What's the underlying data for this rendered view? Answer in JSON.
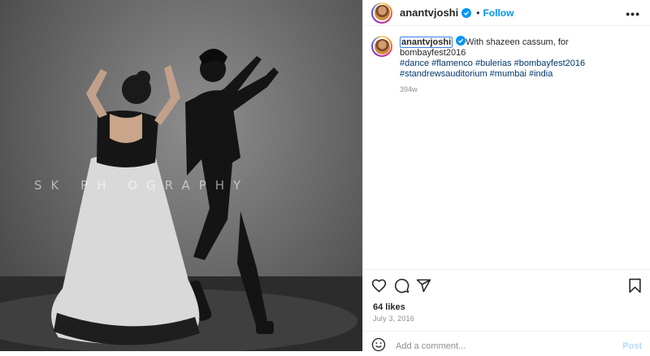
{
  "post": {
    "username": "anantvjoshi",
    "follow_label": "Follow",
    "separator": "•",
    "more_label": "•••",
    "caption_text": "With shazeen cassum, for bombayfest2016",
    "hashtags_line1": "#dance #flamenco #bulerias #bombayfest2016",
    "hashtags_line2": "#standrewsauditorium #mumbai #india",
    "age": "394w",
    "likes": "64 likes",
    "date": "July 3, 2016",
    "comment_placeholder": "Add a comment...",
    "post_label": "Post"
  },
  "photo": {
    "watermark": "SK PH  OGRAPHY"
  },
  "icons": {
    "verified": "verified-badge-icon",
    "like": "heart-icon",
    "comment": "comment-icon",
    "share": "share-icon",
    "save": "bookmark-icon",
    "emoji": "emoji-icon"
  },
  "colors": {
    "accent": "#0095f6",
    "hashtag": "#00376b",
    "muted": "#8e8e8e"
  }
}
